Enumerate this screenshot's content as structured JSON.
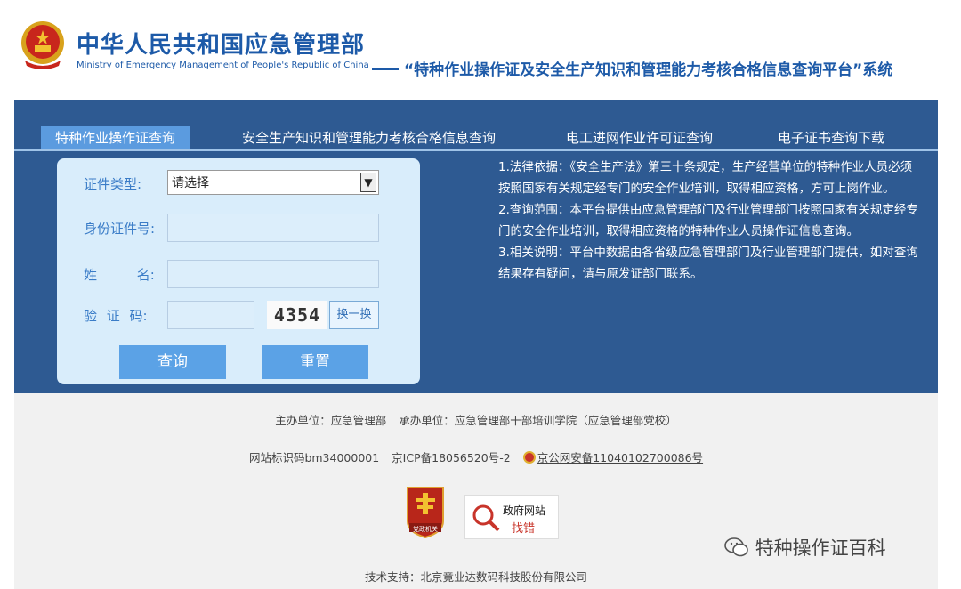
{
  "header": {
    "title_cn": "中华人民共和国应急管理部",
    "title_en": "Ministry of Emergency Management of People's Republic of China",
    "system_title": "“特种作业操作证及安全生产知识和管理能力考核合格信息查询平台”系统"
  },
  "tabs": [
    {
      "label": "特种作业操作证查询",
      "active": true
    },
    {
      "label": "安全生产知识和管理能力考核合格信息查询",
      "active": false
    },
    {
      "label": "电工进网作业许可证查询",
      "active": false
    },
    {
      "label": "电子证书查询下载",
      "active": false
    }
  ],
  "form": {
    "cert_type_label": "证件类型:",
    "cert_type_value": "请选择",
    "id_label": "身份证件号:",
    "name_label": "姓 名:",
    "captcha_label": "验 证 码:",
    "captcha_value": "4354",
    "captcha_refresh": "换一换",
    "query_button": "查询",
    "reset_button": "重置"
  },
  "info": {
    "p1": "1.法律依据：《安全生产法》第三十条规定，生产经营单位的特种作业人员必须按照国家有关规定经专门的安全作业培训，取得相应资格，方可上岗作业。",
    "p2": "2.查询范围：本平台提供由应急管理部门及行业管理部门按照国家有关规定经专门的安全作业培训，取得相应资格的特种作业人员操作证信息查询。",
    "p3": "3.相关说明：平台中数据由各省级应急管理部门及行业管理部门提供，如对查询结果存有疑问，请与原发证部门联系。"
  },
  "footer": {
    "sponsor": "主办单位：应急管理部",
    "organizer": "承办单位：应急管理部干部培训学院（应急管理部党校）",
    "site_code": "网站标识码bm34000001",
    "icp": "京ICP备18056520号-2",
    "police": "京公网安备11040102700086号",
    "badge1": "党政机关",
    "badge2_line1": "政府网站",
    "badge2_line2": "找错",
    "tech_support": "技术支持：北京竟业达数码科技股份有限公司"
  },
  "watermark": "特种操作证百科",
  "colors": {
    "brand_blue": "#1d5aa8",
    "band_blue": "#2e5a92",
    "tab_active": "#5b9bdf",
    "button_blue": "#5ba2e6",
    "panel_bg": "#d9edfb"
  },
  "icons": {
    "emblem": "national-emblem-icon",
    "dropdown": "chevron-down-icon",
    "police": "police-badge-icon",
    "wechat": "wechat-icon"
  }
}
